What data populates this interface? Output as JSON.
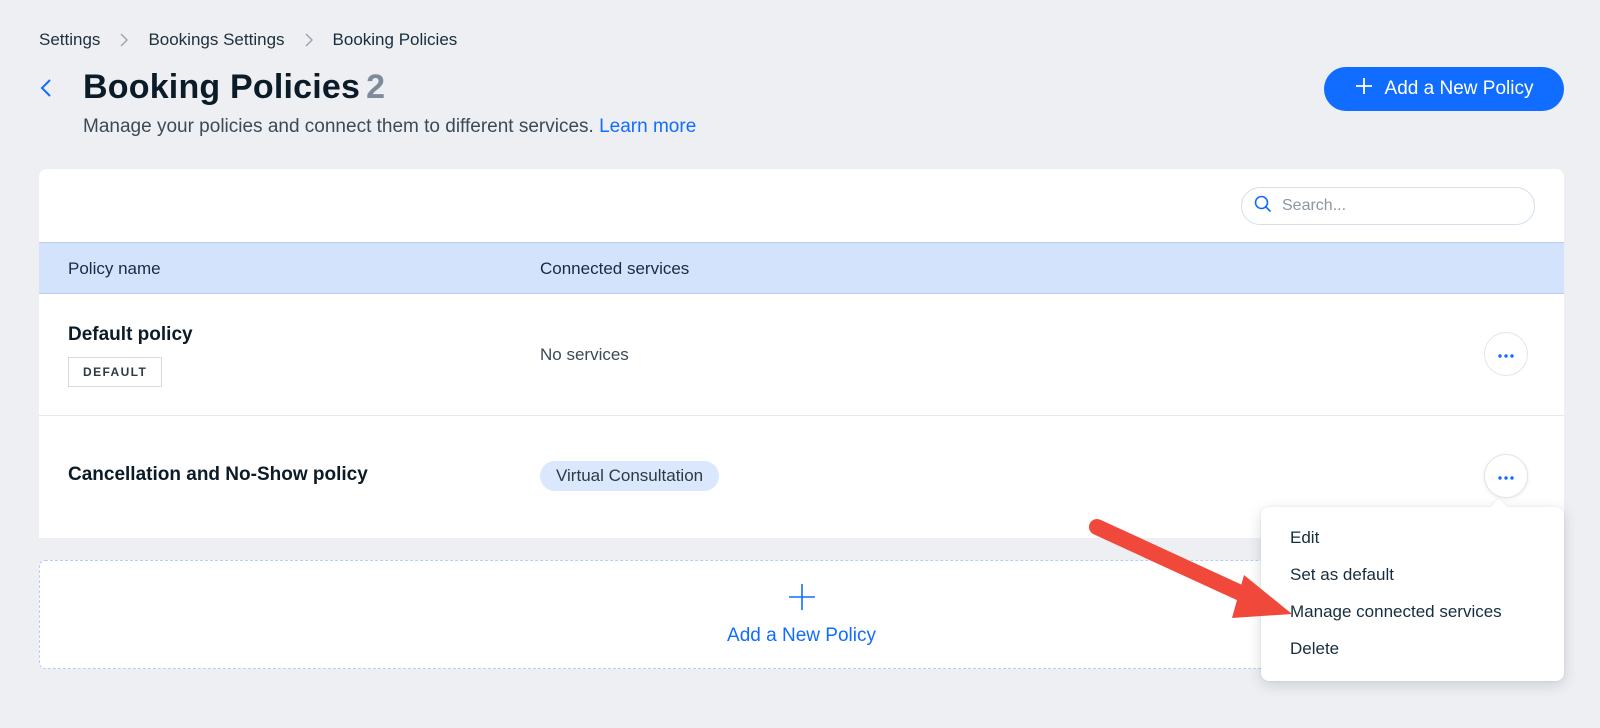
{
  "breadcrumb": {
    "items": [
      "Settings",
      "Bookings Settings",
      "Booking Policies"
    ]
  },
  "header": {
    "title": "Booking Policies",
    "count": "2",
    "subtitle": "Manage your policies and connect them to different services.",
    "learn_more": "Learn more",
    "add_button": "Add a New Policy"
  },
  "search": {
    "placeholder": "Search..."
  },
  "table": {
    "columns": [
      "Policy name",
      "Connected services"
    ],
    "rows": [
      {
        "name": "Default policy",
        "badge": "DEFAULT",
        "services": "No services"
      },
      {
        "name": "Cancellation and No-Show policy",
        "services": "Virtual Consultation"
      }
    ]
  },
  "add_area": {
    "label": "Add a New Policy"
  },
  "menu": {
    "items": [
      "Edit",
      "Set as default",
      "Manage connected services",
      "Delete"
    ]
  },
  "colors": {
    "accent": "#116dff",
    "header_bg": "#d4e3fc",
    "page_bg": "#eeeff3",
    "annotation_arrow": "#f0493c"
  }
}
